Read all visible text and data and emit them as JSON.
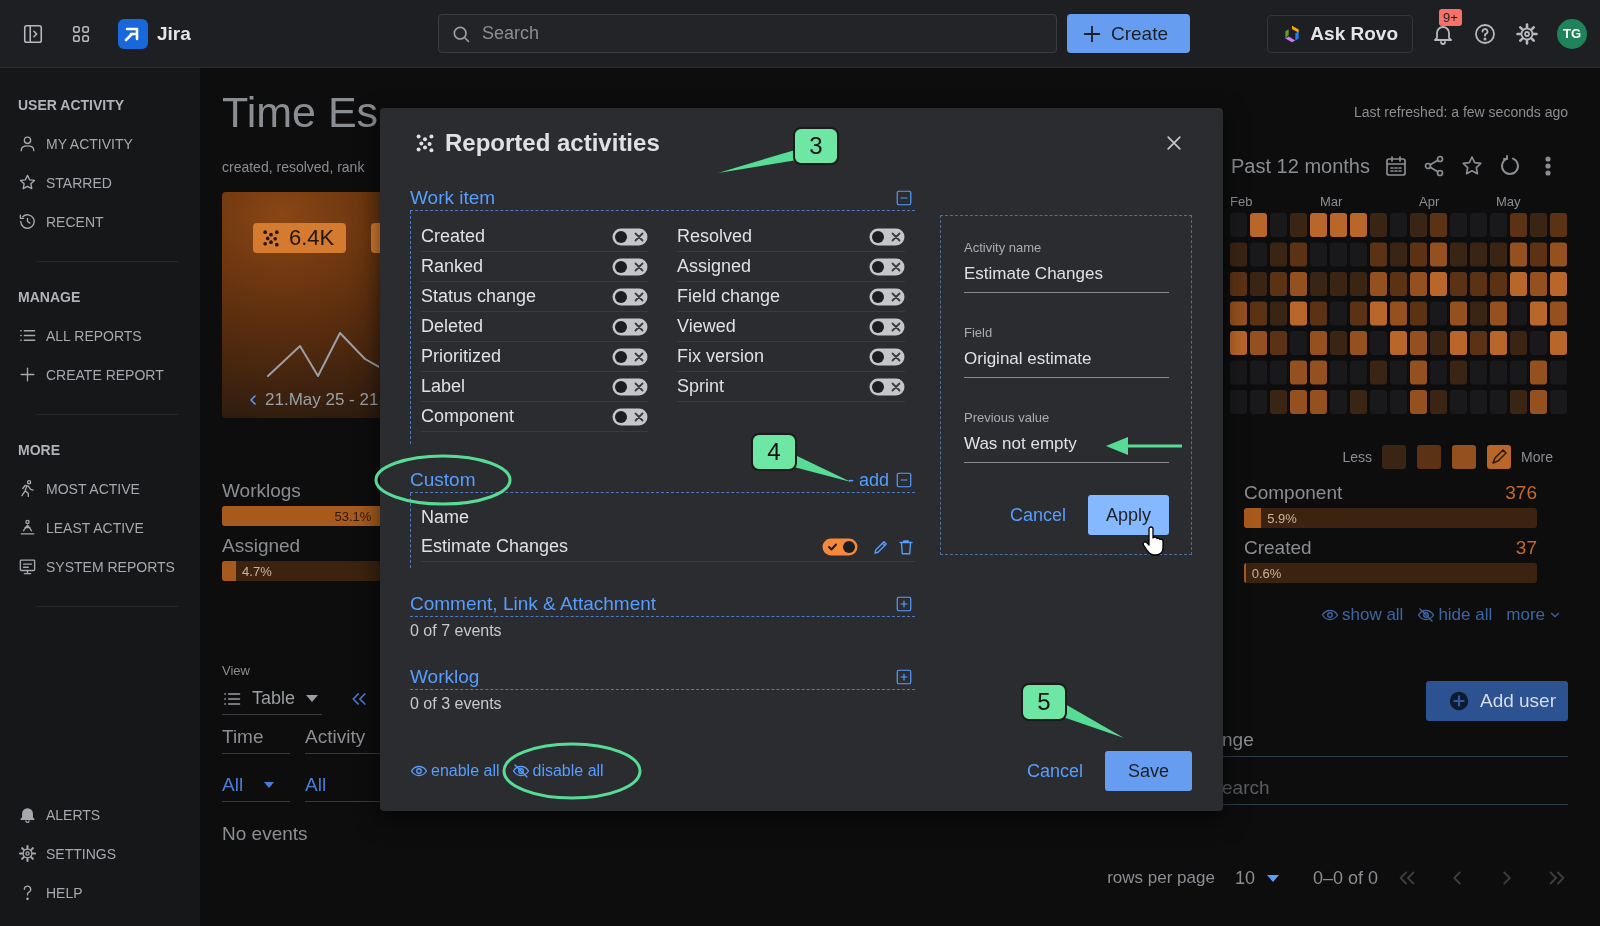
{
  "topbar": {
    "product": "Jira",
    "search": {
      "placeholder": "Search"
    },
    "create": "Create",
    "assistant": "Ask Rovo",
    "notifications": "9+",
    "avatar": "TG"
  },
  "sidebar": {
    "sections": [
      {
        "title": "USER ACTIVITY",
        "items": [
          "MY ACTIVITY",
          "STARRED",
          "RECENT"
        ]
      },
      {
        "title": "MANAGE",
        "items": [
          "ALL REPORTS",
          "CREATE REPORT"
        ]
      },
      {
        "title": "MORE",
        "items": [
          "MOST ACTIVE",
          "LEAST ACTIVE",
          "SYSTEM REPORTS"
        ]
      }
    ],
    "footer": [
      "ALERTS",
      "SETTINGS",
      "HELP"
    ]
  },
  "report": {
    "title": "Time Es",
    "subtitle": "created, resolved, rank",
    "summary_badge": "6.4K",
    "date_range": "21.May 25 - 21",
    "left_bars": [
      {
        "label": "Worklogs",
        "reading": "53.1%",
        "level": 0.531
      },
      {
        "label": "Assigned",
        "reading": "4.7%",
        "level": 0.047
      }
    ],
    "view_label": "View",
    "view": "Table",
    "columns": [
      "Time",
      "Activity"
    ],
    "filters": [
      "All",
      "All"
    ],
    "empty": "No events",
    "refreshed": "Last refreshed: a few seconds ago",
    "period": "Past 12 months",
    "months": [
      "Feb",
      "Mar",
      "Apr",
      "May"
    ],
    "legend": {
      "low": "Less",
      "high": "More"
    },
    "right_bars": [
      {
        "label": "Component",
        "count": "376",
        "reading": "5.9%",
        "level": 0.059
      },
      {
        "label": "Created",
        "count": "37",
        "reading": "0.6%",
        "level": 0.006
      }
    ],
    "links": [
      "show all",
      "hide all",
      "more"
    ],
    "add_user": "Add user",
    "column_3": "nge",
    "filter_3": "earch",
    "pagination": {
      "label": "rows per page",
      "rows": "10",
      "range": "0–0 of 0"
    }
  },
  "modal": {
    "title": "Reported activities",
    "sections": [
      {
        "kind": "toggles",
        "title": "Work item",
        "expanded": true,
        "items": [
          {
            "label": "Created",
            "on": false
          },
          {
            "label": "Ranked",
            "on": false
          },
          {
            "label": "Status change",
            "on": false
          },
          {
            "label": "Deleted",
            "on": false
          },
          {
            "label": "Prioritized",
            "on": false
          },
          {
            "label": "Label",
            "on": false
          },
          {
            "label": "Component",
            "on": false
          },
          {
            "label": "Resolved",
            "on": false
          },
          {
            "label": "Assigned",
            "on": false
          },
          {
            "label": "Field change",
            "on": false
          },
          {
            "label": "Viewed",
            "on": false
          },
          {
            "label": "Fix version",
            "on": false
          },
          {
            "label": "Sprint",
            "on": false
          }
        ]
      },
      {
        "kind": "custom",
        "title": "Custom",
        "add": "- add",
        "expanded": true,
        "header": "Name",
        "items": [
          {
            "label": "Estimate Changes",
            "on": true
          }
        ]
      },
      {
        "kind": "summary",
        "title": "Comment, Link & Attachment",
        "expanded": false,
        "summary": "0 of 7 events"
      },
      {
        "kind": "summary",
        "title": "Worklog",
        "expanded": false,
        "summary": "0 of 3 events"
      }
    ],
    "editor": {
      "fields": [
        {
          "label": "Activity name",
          "value": "Estimate Changes"
        },
        {
          "label": "Field",
          "value": "Original estimate"
        },
        {
          "label": "Previous value",
          "value": "Was not empty"
        }
      ],
      "cancel": "Cancel",
      "apply": "Apply"
    },
    "enable_all": "enable all",
    "disable_all": "disable all",
    "cancel": "Cancel",
    "save": "Save"
  },
  "annotations": {
    "callouts": [
      "3",
      "4",
      "5"
    ]
  }
}
